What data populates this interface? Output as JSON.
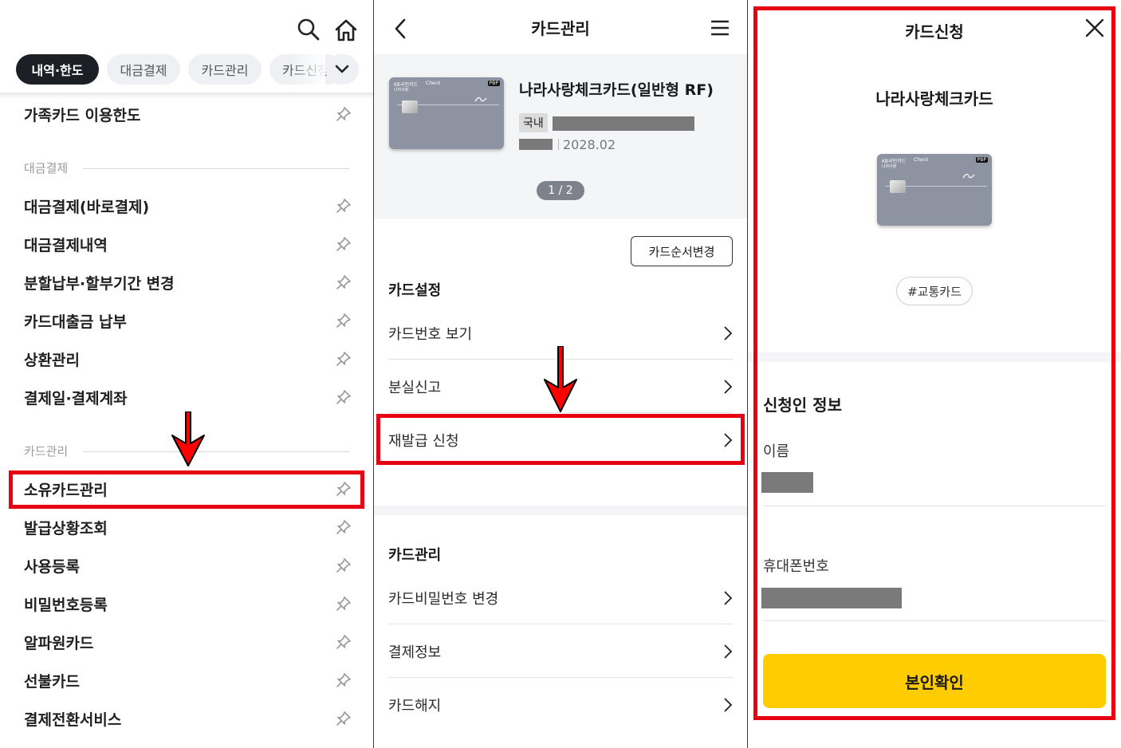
{
  "panel_menu": {
    "chips": [
      "내역·한도",
      "대금결제",
      "카드관리",
      "카드신청"
    ],
    "items_top": [
      "가족카드 이용한도"
    ],
    "section_payment": "대금결제",
    "payment_items": [
      "대금결제(바로결제)",
      "대금결제내역",
      "분할납부·할부기간 변경",
      "카드대출금 납부",
      "상환관리",
      "결제일·결제계좌"
    ],
    "section_card": "카드관리",
    "card_items": [
      "소유카드관리",
      "발급상황조회",
      "사용등록",
      "비밀번호등록",
      "알파원카드",
      "선불카드",
      "결제전환서비스"
    ]
  },
  "panel_card_mgmt": {
    "title": "카드관리",
    "card_name": "나라사랑체크카드(일반형 RF)",
    "domestic_badge": "국내",
    "expiry": "2028.02",
    "pager": "1 / 2",
    "reorder_button": "카드순서변경",
    "section_settings": "카드설정",
    "settings_rows": [
      "카드번호 보기",
      "분실신고",
      "재발급 신청"
    ],
    "section_manage": "카드관리",
    "manage_rows": [
      "카드비밀번호 변경",
      "결제정보",
      "카드해지"
    ]
  },
  "panel_apply": {
    "title": "카드신청",
    "card_name": "나라사랑체크카드",
    "tag": "#교통카드",
    "section": "신청인 정보",
    "name_label": "이름",
    "phone_label": "휴대폰번호",
    "confirm_button": "본인확인"
  },
  "card_art": {
    "brand": "KB국민카드",
    "type": "Check",
    "sub": "나라사랑",
    "logo": "PBP"
  },
  "colors": {
    "highlight": "#e60012",
    "primary_button": "#ffcc00",
    "active_chip": "#1c1f26",
    "card": "#8d93a1"
  }
}
